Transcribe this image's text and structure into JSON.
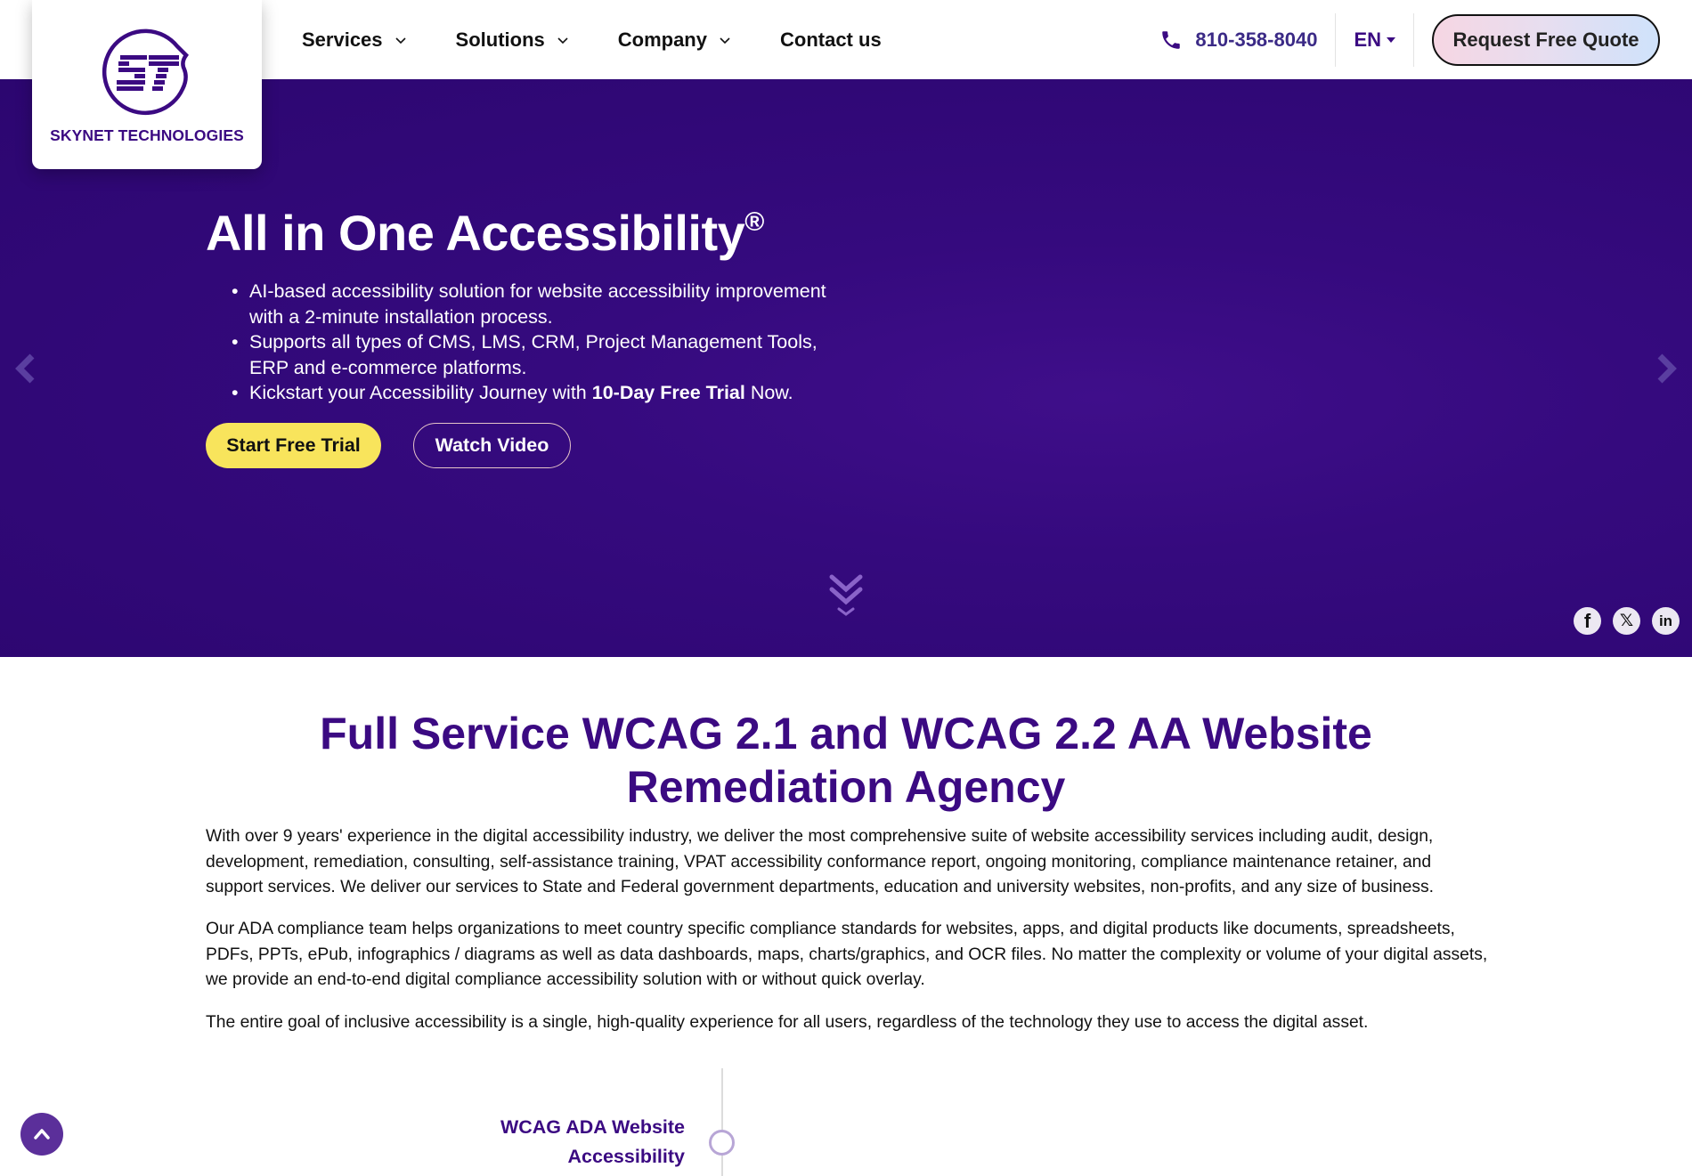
{
  "brand": {
    "name": "SKYNET TECHNOLOGIES",
    "monogram": "ST",
    "primary_color": "#3b0a82",
    "accent_yellow": "#f8e45c"
  },
  "nav": {
    "items": [
      {
        "label": "Services",
        "has_dropdown": true
      },
      {
        "label": "Solutions",
        "has_dropdown": true
      },
      {
        "label": "Company",
        "has_dropdown": true
      },
      {
        "label": "Contact us",
        "has_dropdown": false
      }
    ],
    "phone": "810-358-8040",
    "language": "EN",
    "cta_label": "Request Free Quote"
  },
  "hero": {
    "title": "All in One Accessibility",
    "title_mark": "®",
    "bullets": [
      {
        "text": "AI-based accessibility solution for website accessibility improvement with a 2-minute installation process."
      },
      {
        "text": "Supports all types of CMS, LMS, CRM, Project Management Tools, ERP and e-commerce platforms."
      },
      {
        "pre": "Kickstart your Accessibility Journey with ",
        "bold": "10-Day Free Trial",
        "post": " Now."
      }
    ],
    "primary_button": "Start Free Trial",
    "secondary_button": "Watch Video",
    "icons": {
      "prev": "chevron-left-icon",
      "next": "chevron-right-icon",
      "scroll": "double-chevron-down-icon"
    },
    "social": [
      {
        "name": "facebook",
        "glyph": "f"
      },
      {
        "name": "x",
        "glyph": "𝕏"
      },
      {
        "name": "linkedin",
        "glyph": "in"
      }
    ]
  },
  "main": {
    "title_line1": "Full Service WCAG 2.1 and WCAG 2.2 AA Website",
    "title_line2": "Remediation Agency",
    "paragraphs": [
      "With over 9 years' experience in the digital accessibility industry, we deliver the most comprehensive suite of website accessibility services including audit, design, development, remediation, consulting, self-assistance training, VPAT accessibility conformance report, ongoing monitoring, compliance maintenance retainer, and support services. We deliver our services to State and Federal government departments, education and university websites, non-profits, and any size of business.",
      "Our ADA compliance team helps organizations to meet country specific compliance standards for websites, apps, and digital products like documents, spreadsheets, PDFs, PPTs, ePub, infographics / diagrams as well as data dashboards, maps, charts/graphics, and OCR files. No matter the complexity or volume of your digital assets, we provide an end-to-end digital compliance accessibility solution with or without quick overlay.",
      "The entire goal of inclusive accessibility is a single, high-quality experience for all users, regardless of the technology they use to access the digital asset."
    ],
    "timeline": {
      "label_line1": "WCAG ADA Website",
      "label_line2": "Accessibility"
    }
  },
  "back_to_top": {
    "icon": "chevron-up-icon"
  }
}
